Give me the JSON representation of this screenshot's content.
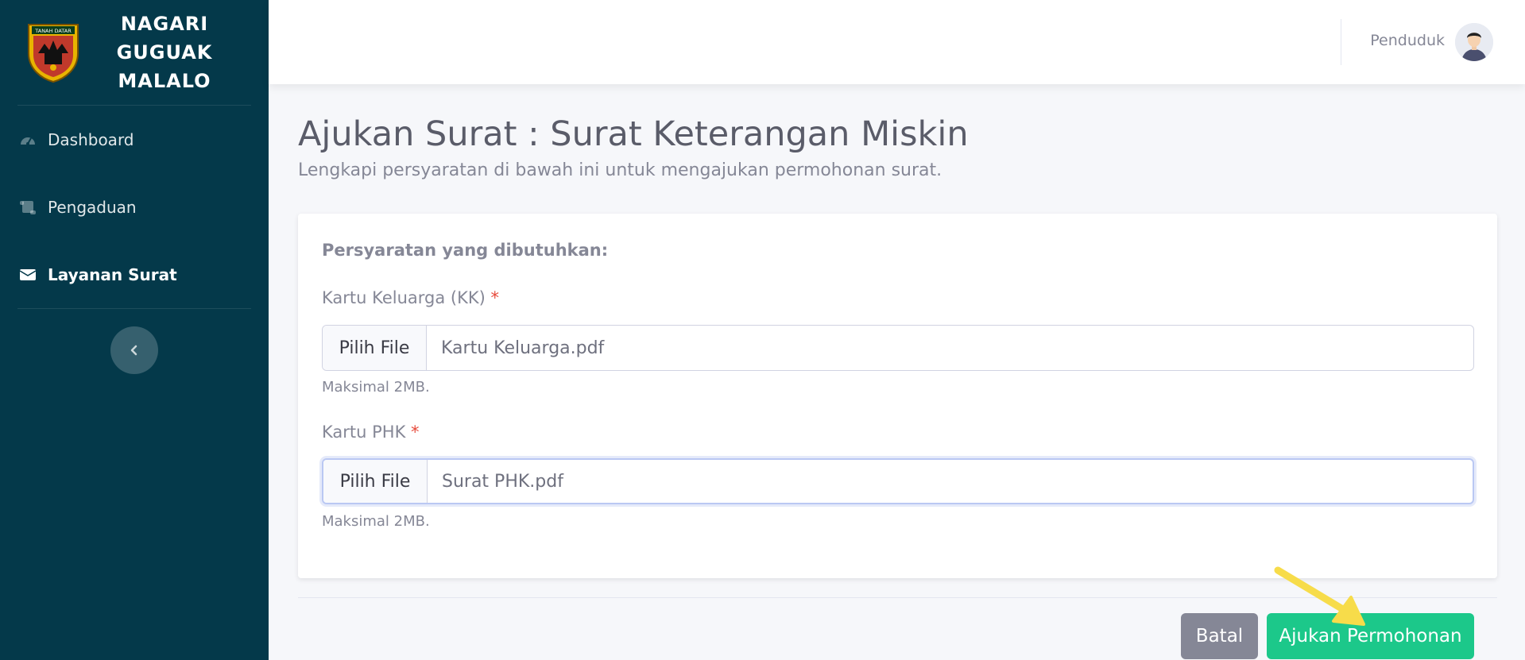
{
  "brand": {
    "line1": "NAGARI",
    "line2": "GUGUAK",
    "line3": "MALALO",
    "logo_caption": "TANAH DATAR"
  },
  "sidebar": {
    "items": [
      {
        "label": "Dashboard",
        "icon": "gauge-icon"
      },
      {
        "label": "Pengaduan",
        "icon": "scroll-icon"
      },
      {
        "label": "Layanan Surat",
        "icon": "envelope-icon",
        "active": true
      }
    ],
    "toggle_icon": "chevron-left-icon"
  },
  "topbar": {
    "user_name": "Penduduk"
  },
  "page": {
    "title": "Ajukan Surat : Surat Keterangan Miskin",
    "subtitle": "Lengkapi persyaratan di bawah ini untuk mengajukan permohonan surat."
  },
  "form": {
    "requirements_title": "Persyaratan yang dibutuhkan:",
    "fields": [
      {
        "label": "Kartu Keluarga (KK)",
        "required_mark": "*",
        "button": "Pilih File",
        "file_name": "Kartu Keluarga.pdf",
        "help": "Maksimal 2MB."
      },
      {
        "label": "Kartu PHK",
        "required_mark": "*",
        "button": "Pilih File",
        "file_name": "Surat PHK.pdf",
        "help": "Maksimal 2MB."
      }
    ]
  },
  "actions": {
    "cancel_label": "Batal",
    "submit_label": "Ajukan Permohonan"
  },
  "colors": {
    "sidebar_bg": "#04394a",
    "submit": "#1cc88a",
    "cancel": "#858796",
    "annotation_arrow": "#f7dc4a"
  }
}
